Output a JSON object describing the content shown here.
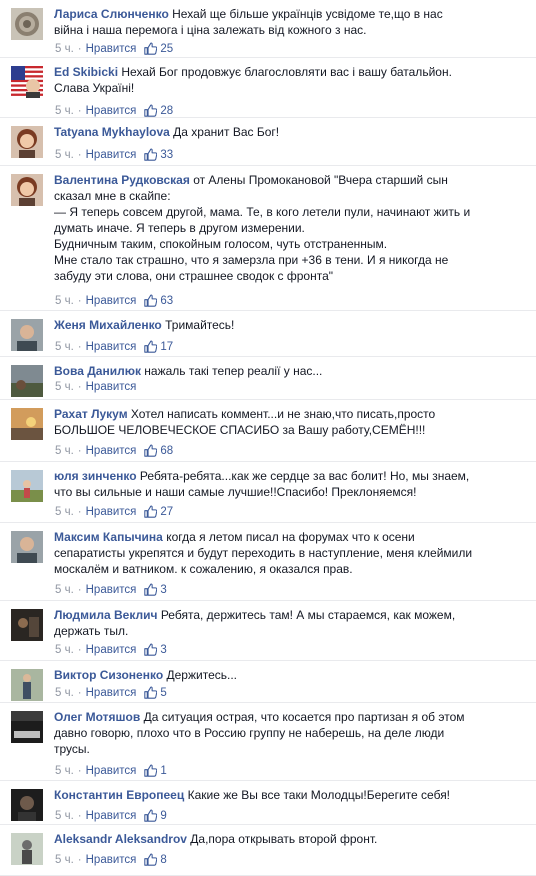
{
  "ui": {
    "like_label": "Нравится",
    "separator": "·"
  },
  "colors": {
    "author": "#3b5998",
    "meta": "#9197a3",
    "text": "#141823",
    "divider": "#e9eaed"
  },
  "comments": [
    {
      "author": "Лариса Слюнченко",
      "text": "Нехай ще більше українців усвідоме те,що в нас війна і наша перемога і ціна залежать від кожного з нас.",
      "time": "5 ч.",
      "likes": "25",
      "avatar": "ornament-avatar"
    },
    {
      "author": "Ed Skibicki",
      "text": "Нехай Бог продовжує благословляти вас і вашу батальйон. Слава Україні!",
      "time": "5 ч.",
      "likes": "28",
      "avatar": "us-flag-avatar"
    },
    {
      "author": "Tatyana Mykhaylova",
      "text": "Да хранит Вас Бог!",
      "time": "5 ч.",
      "likes": "33",
      "avatar": "woman-portrait-avatar"
    },
    {
      "author": "Валентина Рудковская",
      "text": "от Алены Промокановой \"Вчера старший сын сказал мне в скайпе:\n— Я теперь совсем другой, мама. Те, в кого летели пули, начинают жить и думать иначе. Я теперь в другом измерении.\nБудничным таким, спокойным голосом, чуть отстраненным.\nМне стало так страшно, что я замерзла при +36 в тени. И я никогда не забуду эти слова, они страшнее сводок с фронта\"",
      "time": "5 ч.",
      "likes": "63",
      "avatar": "woman-portrait-avatar"
    },
    {
      "author": "Женя Михайленко",
      "text": "Тримайтесь!",
      "time": "5 ч.",
      "likes": "17",
      "avatar": "man-portrait-avatar"
    },
    {
      "author": "Вова Данилюк",
      "text": "нажаль такі тепер реалії у нас...",
      "time": "5 ч.",
      "likes": "",
      "avatar": "landscape-avatar"
    },
    {
      "author": "Рахат Лукум",
      "text": "Хотел написать коммент...и не знаю,что писать,просто БОЛЬШОЕ ЧЕЛОВЕЧЕСКОЕ СПАСИБО за Вашу работу,СЕМЁН!!!",
      "time": "5 ч.",
      "likes": "68",
      "avatar": "sunset-avatar"
    },
    {
      "author": "юля зинченко",
      "text": "Ребята-ребята...как же сердце за вас болит! Но, мы знаем, что вы сильные и наши самые лучшие!!Спасибо! Преклоняемся!",
      "time": "5 ч.",
      "likes": "27",
      "avatar": "outdoor-avatar"
    },
    {
      "author": "Максим Капычина",
      "text": "когда я летом писал на форумах что к осени сепаратисты укрепятся и будут переходить в наступление, меня клеймили москалём и ватником. к сожалению, я оказался прав.",
      "time": "5 ч.",
      "likes": "3",
      "avatar": "man-portrait-avatar"
    },
    {
      "author": "Людмила Веклич",
      "text": "Ребята, держитесь там! А мы стараемся, как можем, держать тыл.",
      "time": "5 ч.",
      "likes": "3",
      "avatar": "dark-scene-avatar"
    },
    {
      "author": "Виктор Сизоненко",
      "text": "Держитесь...",
      "time": "5 ч.",
      "likes": "5",
      "avatar": "man-standing-avatar"
    },
    {
      "author": "Олег Мотяшов",
      "text": "Да ситуация острая, что косается про партизан я об этом давно говорю, плохо что в Россию группу не наберешь, на деле люди трусы.",
      "time": "5 ч.",
      "likes": "1",
      "avatar": "war-poster-avatar"
    },
    {
      "author": "Константин Европеец",
      "text": "Какие же Вы все таки Молодцы!Берегите себя!",
      "time": "5 ч.",
      "likes": "9",
      "avatar": "dark-portrait-avatar"
    },
    {
      "author": "Aleksandr Aleksandrov",
      "text": "Да,пора открывать второй фронт.",
      "time": "5 ч.",
      "likes": "8",
      "avatar": "figure-avatar"
    }
  ]
}
